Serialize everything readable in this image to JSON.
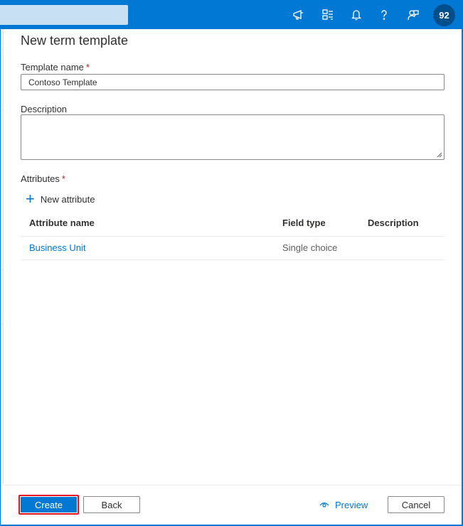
{
  "topbar": {
    "icons": [
      "megaphone-icon",
      "switch-directory-icon",
      "bell-icon",
      "help-icon",
      "feedback-icon"
    ],
    "avatar_initials": "92",
    "accent": "#0078d4"
  },
  "panel": {
    "title": "New term template",
    "template_name_label": "Template name",
    "template_name_value": "Contoso Template",
    "description_label": "Description",
    "description_value": "",
    "attributes_label": "Attributes",
    "required_marker": "*",
    "new_attribute_label": "New attribute",
    "table": {
      "headers": [
        "Attribute name",
        "Field type",
        "Description"
      ],
      "rows": [
        {
          "name": "Business Unit",
          "field_type": "Single choice",
          "description": ""
        }
      ]
    }
  },
  "footer": {
    "create_label": "Create",
    "back_label": "Back",
    "preview_label": "Preview",
    "cancel_label": "Cancel"
  }
}
